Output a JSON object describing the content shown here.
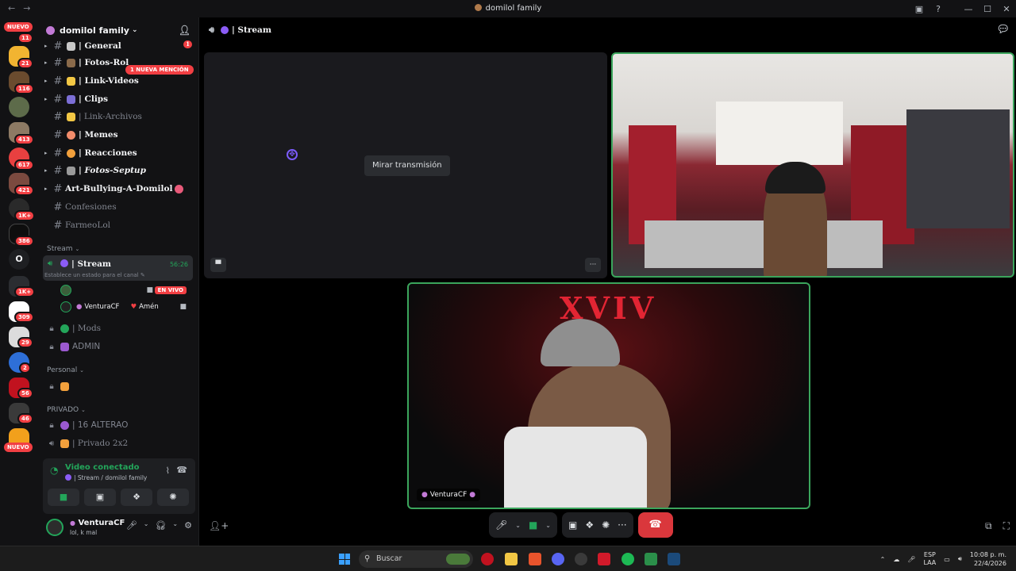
{
  "window": {
    "title": "domilol family",
    "back": "←",
    "forward": "→",
    "controls": [
      "▣",
      "?",
      "—",
      "☐",
      "✕"
    ]
  },
  "rail": {
    "new_top": "NUEVO",
    "new_bottom": "NUEVO",
    "badges": [
      "11",
      "21",
      "116",
      "413",
      "617",
      "421",
      "1K+",
      "386",
      "1K+",
      "309",
      "29",
      "2",
      "56",
      "46"
    ],
    "letter_server": "O"
  },
  "guild": {
    "name": "domilol family",
    "chevron": "⌄",
    "mention_pill": "1 NUEVA MENCIÓN",
    "general_count": "1"
  },
  "channels": [
    {
      "name": "| General",
      "style": "bold"
    },
    {
      "name": "| Fotos-Rol",
      "style": "bold"
    },
    {
      "name": "| Link-Videos",
      "style": "bold"
    },
    {
      "name": "| Clips",
      "style": "bold"
    },
    {
      "name": "| Link-Archivos",
      "style": "muted"
    },
    {
      "name": "| Memes",
      "style": "bold"
    },
    {
      "name": "| Reacciones",
      "style": "bold"
    },
    {
      "name": "| Fotos-Septup",
      "style": "bold"
    },
    {
      "name": "Art-Bullying-A-Domilol",
      "style": "bold"
    },
    {
      "name": "Confesiones",
      "style": "muted"
    },
    {
      "name": "FarmeoLol",
      "style": "muted"
    }
  ],
  "categories": {
    "stream": "Stream",
    "personal": "Personal",
    "privado": "PRIVADO"
  },
  "voice_channel": {
    "name": "| Stream",
    "timer": "56:26",
    "status_hint": "Establece un estado para el canal",
    "live_label": "EN VIVO",
    "user2_name": "VenturaCF",
    "user2_tag": "Amén"
  },
  "locked_channels": {
    "mods": "| Mods",
    "admin": "ADMIN",
    "alterao": "| 16 ALTERAO",
    "privado2x2": "| Privado 2x2"
  },
  "voice_panel": {
    "status": "Video conectado",
    "location": "| Stream / domilol family"
  },
  "user_panel": {
    "name": "VenturaCF",
    "status": "lol, k mal"
  },
  "main": {
    "channel": "| Stream",
    "watch_button": "Mirar transmisión",
    "cam2_name": "VenturaCF",
    "neon_text": "XVIV"
  },
  "taskbar": {
    "search_placeholder": "Buscar",
    "lang_top": "ESP",
    "lang_bottom": "LAA",
    "time": "10:08 p. m.",
    "date": "22/4/2026"
  },
  "colors": {
    "accent_green": "#23a55a",
    "danger": "#da373c",
    "badge_red": "#f23f43",
    "purple": "#8b5cf6"
  }
}
